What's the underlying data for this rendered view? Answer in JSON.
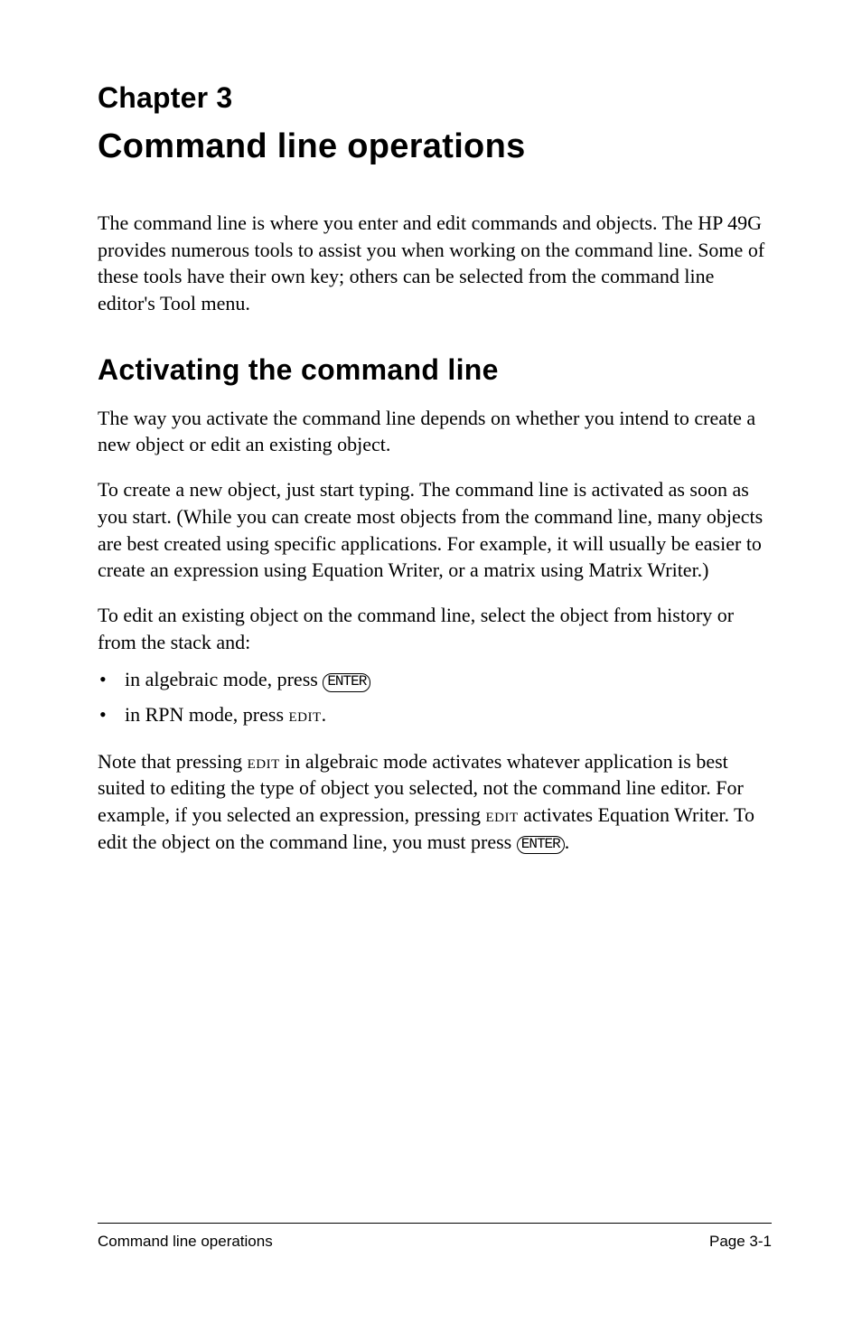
{
  "chapter_label": "Chapter 3",
  "chapter_title": "Command line operations",
  "intro_text": "The command line is where you enter and edit commands and objects. The HP 49G provides numerous tools to assist you when working on the command line. Some of these tools have their own key; others can be selected from the command line editor's Tool menu.",
  "section1": {
    "title": "Activating the command line",
    "p1": "The way you activate the command line depends on whether you intend to create a new object or edit an existing object.",
    "p2": "To create a new object, just start typing. The command line is activated as soon as you start. (While you can create most objects from the command line, many objects are best created using specific applications. For example, it will usually be easier to create an expression using Equation Writer, or a matrix using Matrix Writer.)",
    "p3": "To edit an existing object on the command line, select the object from history or from the stack and:",
    "bullets": [
      {
        "pre": "in algebraic mode, press ",
        "key": "ENTER",
        "post": ""
      },
      {
        "pre": "in RPN mode, press ",
        "sc": "edit",
        "post": "."
      }
    ],
    "p4_pre": "Note that pressing ",
    "p4_sc1": "edit",
    "p4_mid1": " in algebraic mode activates whatever application is best suited to editing the type of object you selected, not the command line editor. For example, if you selected an expression, pressing ",
    "p4_sc2": "edit",
    "p4_mid2": " activates Equation Writer. To edit the object on the command line, you must press ",
    "p4_key": "ENTER",
    "p4_end": "."
  },
  "footer": {
    "left": "Command line operations",
    "right": "Page 3-1"
  }
}
